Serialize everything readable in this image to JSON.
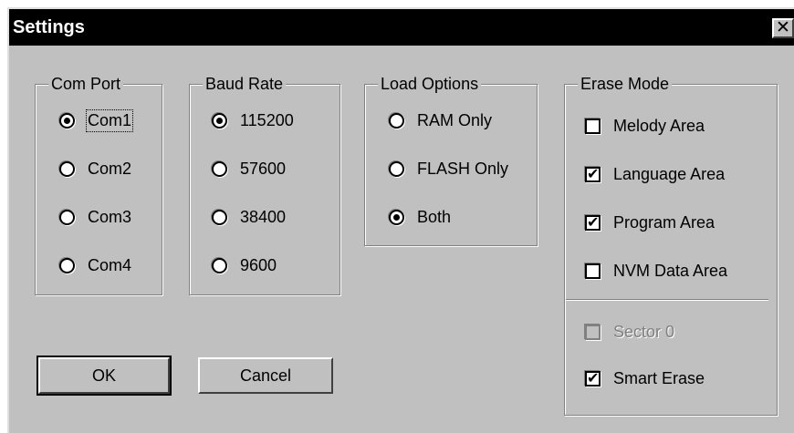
{
  "window": {
    "title": "Settings",
    "close_glyph": "✕"
  },
  "com_port": {
    "title": "Com Port",
    "options": [
      {
        "label": "Com1",
        "selected": true
      },
      {
        "label": "Com2",
        "selected": false
      },
      {
        "label": "Com3",
        "selected": false
      },
      {
        "label": "Com4",
        "selected": false
      }
    ]
  },
  "baud_rate": {
    "title": "Baud Rate",
    "options": [
      {
        "label": "115200",
        "selected": true
      },
      {
        "label": "57600",
        "selected": false
      },
      {
        "label": "38400",
        "selected": false
      },
      {
        "label": "9600",
        "selected": false
      }
    ]
  },
  "load_options": {
    "title": "Load Options",
    "options": [
      {
        "label": "RAM Only",
        "selected": false
      },
      {
        "label": "FLASH Only",
        "selected": false
      },
      {
        "label": "Both",
        "selected": true
      }
    ]
  },
  "erase_mode": {
    "title": "Erase Mode",
    "options": [
      {
        "label": "Melody Area",
        "checked": false
      },
      {
        "label": "Language Area",
        "checked": true
      },
      {
        "label": "Program Area",
        "checked": true
      },
      {
        "label": "NVM Data Area",
        "checked": false
      },
      {
        "label": "Sector 0",
        "checked": false,
        "disabled": true
      },
      {
        "label": "Smart Erase",
        "checked": true
      }
    ]
  },
  "buttons": {
    "ok": "OK",
    "cancel": "Cancel"
  },
  "check_mark": "✔"
}
